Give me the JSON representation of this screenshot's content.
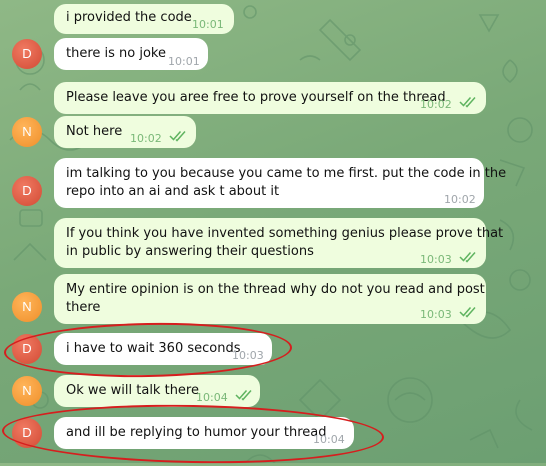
{
  "avatars": {
    "d_initial": "D",
    "n_initial": "N"
  },
  "messages": [
    {
      "from": "me",
      "text": "i provided the code",
      "time": "10:01"
    },
    {
      "from": "D",
      "text": "there is no joke",
      "time": "10:01"
    },
    {
      "from": "N",
      "text": "Please leave you aree free to prove yourself on the thread",
      "time": "10:02",
      "read": true
    },
    {
      "from": "N",
      "text": "Not here",
      "time": "10:02",
      "read": true
    },
    {
      "from": "D",
      "line1": "im talking to you because you came to me first. put the code in the",
      "line2": "repo  into an ai and ask t about it",
      "time": "10:02"
    },
    {
      "from": "N",
      "line1": "If you think you have invented something genius please prove that",
      "line2": "in public by answering their questions",
      "time": "10:03",
      "read": true
    },
    {
      "from": "N",
      "line1": "My entire opinion is on the thread why do not you read and post",
      "line2": "there",
      "time": "10:03",
      "read": true
    },
    {
      "from": "D",
      "text": "i have to wait 360 seconds",
      "time": "10:03"
    },
    {
      "from": "N",
      "text": "Ok we will talk there",
      "time": "10:04",
      "read": true
    },
    {
      "from": "D",
      "text": "and ill be replying to humor your thread",
      "time": "10:04"
    }
  ],
  "colors": {
    "background": "#7aa978",
    "incoming_bubble": "#ffffff",
    "outgoing_bubble": "#effdde",
    "annotation_red": "#d61e1e",
    "avatar_d": "#e0573f",
    "avatar_n": "#f4a03a"
  },
  "icons": {
    "read_receipt": "double-check-icon"
  }
}
